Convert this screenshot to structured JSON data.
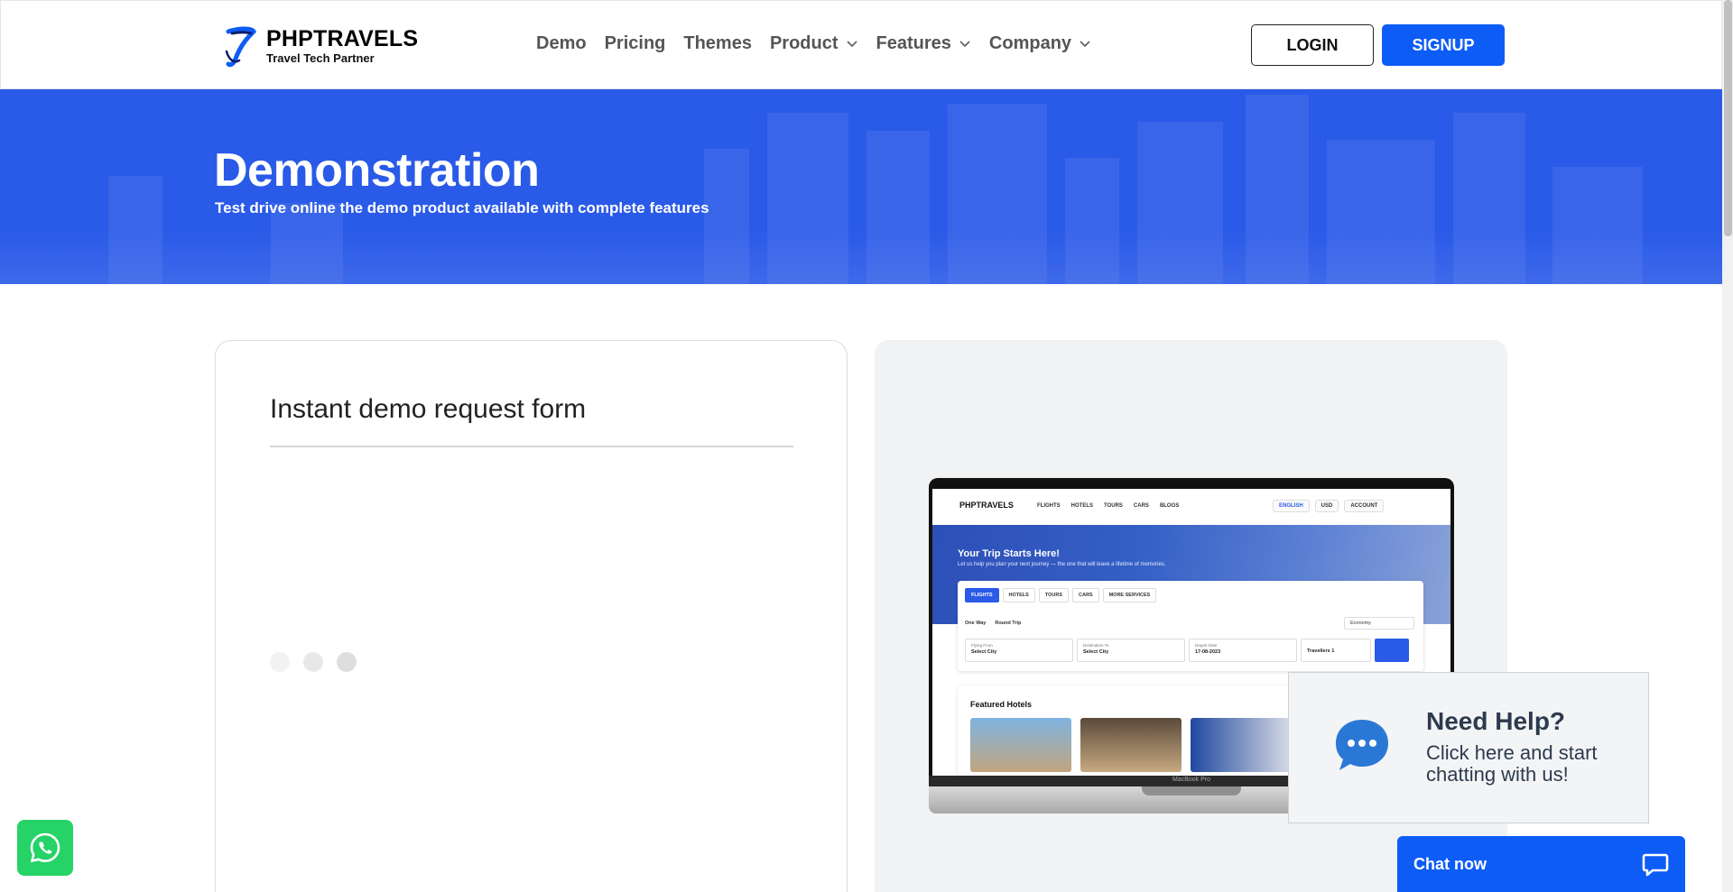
{
  "header": {
    "brand_name": "PHPTRAVELS",
    "brand_tagline": "Travel Tech Partner",
    "nav": [
      {
        "label": "Demo",
        "dropdown": false
      },
      {
        "label": "Pricing",
        "dropdown": false
      },
      {
        "label": "Themes",
        "dropdown": false
      },
      {
        "label": "Product",
        "dropdown": true
      },
      {
        "label": "Features",
        "dropdown": true
      },
      {
        "label": "Company",
        "dropdown": true
      }
    ],
    "login_label": "LOGIN",
    "signup_label": "SIGNUP"
  },
  "hero": {
    "title": "Demonstration",
    "subtitle": "Test drive online the demo product available with complete features"
  },
  "form_card": {
    "title": "Instant demo request form"
  },
  "preview": {
    "mini_site": {
      "brand": "PHPTRAVELS",
      "nav": [
        "FLIGHTS",
        "HOTELS",
        "TOURS",
        "CARS",
        "BLOGS"
      ],
      "language": "ENGLISH",
      "currency": "USD",
      "account": "ACCOUNT",
      "hero_title": "Your Trip Starts Here!",
      "hero_subtitle": "Let us help you plan your next journey — the one that will leave a lifetime of memories.",
      "tabs": [
        "FLIGHTS",
        "HOTELS",
        "TOURS",
        "CARS",
        "MORE SERVICES"
      ],
      "trip_types": [
        "One Way",
        "Round Trip"
      ],
      "cabin_class": "Economy",
      "fields": [
        {
          "label": "Flying From",
          "value": "Select City"
        },
        {
          "label": "Destination To",
          "value": "Select City"
        },
        {
          "label": "Depart Date",
          "value": "17-08-2023"
        },
        {
          "label": "",
          "value": "Travellers 1"
        }
      ],
      "featured_title": "Featured Hotels"
    },
    "laptop_label": "MacBook Pro"
  },
  "help_popup": {
    "title": "Need Help?",
    "line1": "Click here and start",
    "line2": "chatting with us!"
  },
  "chat": {
    "label": "Chat now"
  },
  "colors": {
    "primary": "#0d5cf6",
    "hero_bg": "#2a5ae8",
    "whatsapp": "#25d366",
    "help_text": "#2d3a4e",
    "help_icon": "#2a78d6"
  },
  "icons": {
    "whatsapp": "whatsapp-icon",
    "chat": "chat-bubble-icon",
    "help": "speech-bubble-icon",
    "chevron": "chevron-down-icon"
  }
}
